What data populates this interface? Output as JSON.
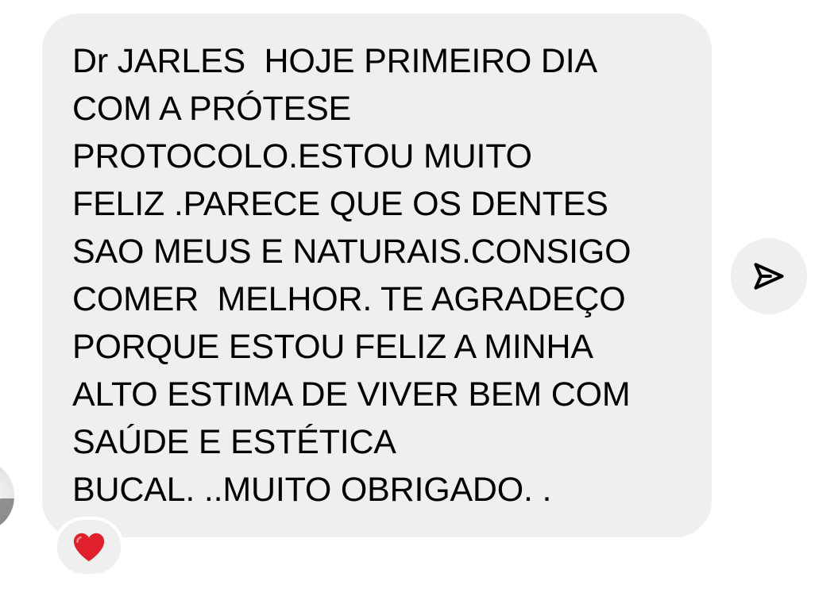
{
  "message": {
    "text": "Dr JARLES  HOJE PRIMEIRO DIA\nCOM A PRÓTESE\nPROTOCOLO.ESTOU MUITO\nFELIZ .PARECE QUE OS DENTES\nSAO MEUS E NATURAIS.CONSIGO\nCOMER  MELHOR. TE AGRADEÇO\nPORQUE ESTOU FELIZ A MINHA\nALTO ESTIMA DE VIVER BEM COM\nSAÚDE E ESTÉTICA\nBUCAL. ..MUITO OBRIGADO. .",
    "bubble_color": "#efefef"
  },
  "reaction": {
    "icon": "red-heart-icon",
    "color": "#e0202c"
  },
  "actions": {
    "share_icon": "paper-plane-icon"
  },
  "sender": {
    "avatar_icon": "avatar"
  }
}
